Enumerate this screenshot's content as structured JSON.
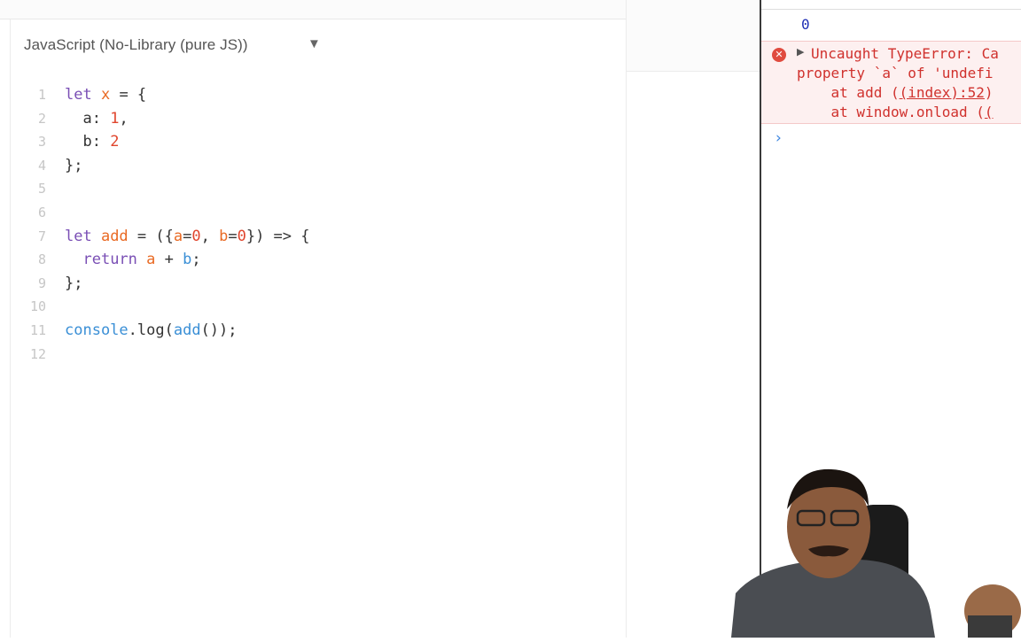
{
  "editor": {
    "language_label": "JavaScript (No-Library (pure JS))",
    "caret": "▼",
    "lines": [
      {
        "n": "1",
        "segments": [
          {
            "t": "let ",
            "c": "kw"
          },
          {
            "t": "x",
            "c": "var"
          },
          {
            "t": " = {",
            "c": "prop"
          }
        ]
      },
      {
        "n": "2",
        "segments": [
          {
            "t": "  a: ",
            "c": "prop"
          },
          {
            "t": "1",
            "c": "num"
          },
          {
            "t": ",",
            "c": "prop"
          }
        ]
      },
      {
        "n": "3",
        "segments": [
          {
            "t": "  b: ",
            "c": "prop"
          },
          {
            "t": "2",
            "c": "num"
          }
        ]
      },
      {
        "n": "4",
        "segments": [
          {
            "t": "};",
            "c": "prop"
          }
        ]
      },
      {
        "n": "5",
        "segments": []
      },
      {
        "n": "6",
        "segments": []
      },
      {
        "n": "7",
        "segments": [
          {
            "t": "let ",
            "c": "kw"
          },
          {
            "t": "add",
            "c": "var"
          },
          {
            "t": " = ({",
            "c": "prop"
          },
          {
            "t": "a",
            "c": "var"
          },
          {
            "t": "=",
            "c": "prop"
          },
          {
            "t": "0",
            "c": "num"
          },
          {
            "t": ", ",
            "c": "prop"
          },
          {
            "t": "b",
            "c": "var"
          },
          {
            "t": "=",
            "c": "prop"
          },
          {
            "t": "0",
            "c": "num"
          },
          {
            "t": "}) => {",
            "c": "prop"
          }
        ]
      },
      {
        "n": "8",
        "segments": [
          {
            "t": "  ",
            "c": "prop"
          },
          {
            "t": "return",
            "c": "kw"
          },
          {
            "t": " ",
            "c": "prop"
          },
          {
            "t": "a",
            "c": "var"
          },
          {
            "t": " + ",
            "c": "prop"
          },
          {
            "t": "b",
            "c": "fn"
          },
          {
            "t": ";",
            "c": "prop"
          }
        ]
      },
      {
        "n": "9",
        "segments": [
          {
            "t": "};",
            "c": "prop"
          }
        ]
      },
      {
        "n": "10",
        "segments": []
      },
      {
        "n": "11",
        "segments": [
          {
            "t": "console",
            "c": "fn"
          },
          {
            "t": ".log(",
            "c": "prop"
          },
          {
            "t": "add",
            "c": "fn"
          },
          {
            "t": "());",
            "c": "prop"
          }
        ]
      },
      {
        "n": "12",
        "segments": []
      }
    ]
  },
  "console": {
    "log_output": "0",
    "error": {
      "line1": "Uncaught TypeError: Ca",
      "line2": "property `a` of 'undefi",
      "line3_prefix": "    at add (",
      "line3_link": "(index):52",
      "line3_suffix": ")",
      "line4_prefix": "    at window.onload (",
      "line4_link": "("
    },
    "prompt_symbol": "›"
  },
  "colors": {
    "error_text": "#d0312d",
    "error_bg": "#fdf0f0",
    "log_number": "#1f2fb5",
    "keyword": "#7a4fb5",
    "variable": "#e96a24",
    "number": "#e0452d",
    "function": "#3a8fd6"
  }
}
